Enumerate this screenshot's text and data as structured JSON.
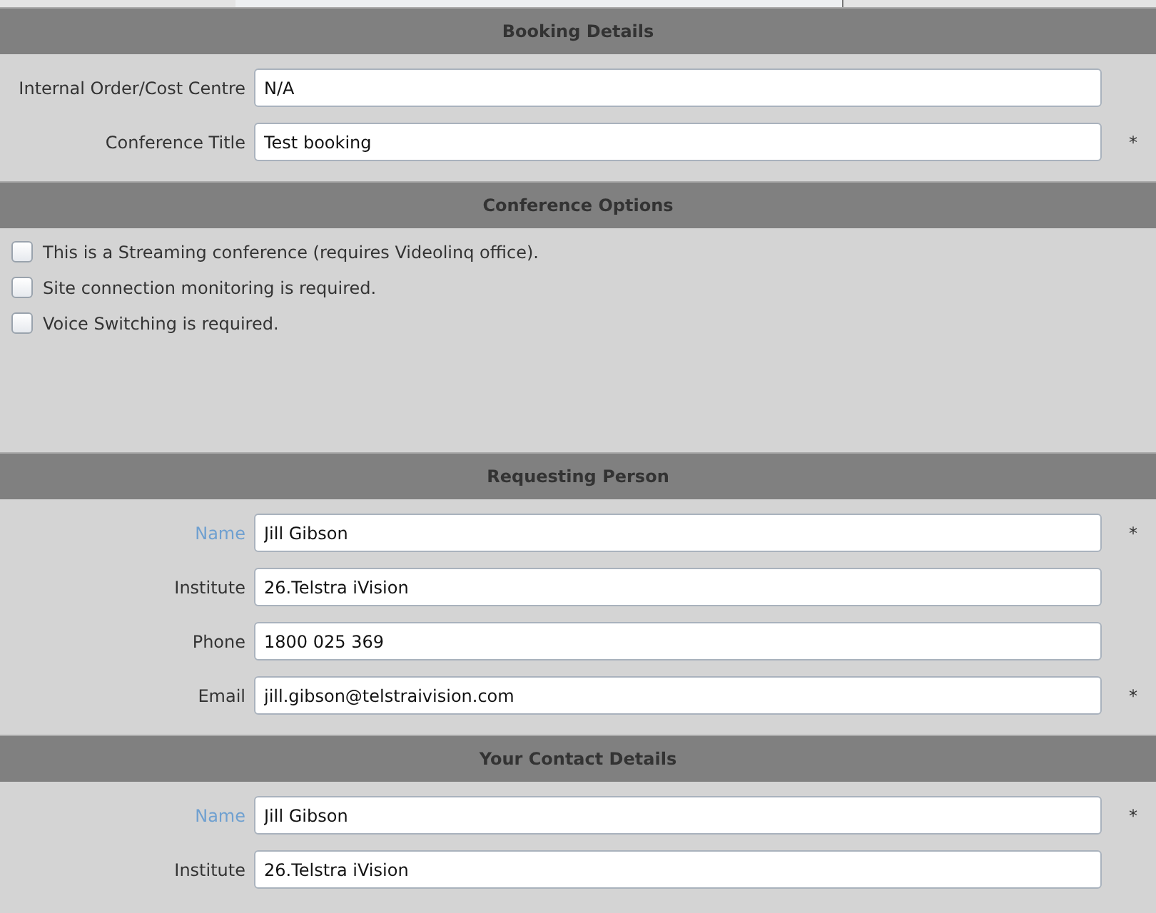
{
  "sections": [
    {
      "title": "Booking Details",
      "kind": "fields",
      "fields": [
        {
          "label": "Internal Order/Cost Centre",
          "value": "N/A",
          "link": false
        },
        {
          "label": "Conference Title",
          "value": "Test booking",
          "link": false,
          "marker": "*"
        }
      ]
    },
    {
      "title": "Conference Options",
      "kind": "checkboxes",
      "options": [
        {
          "label": "This is a Streaming conference (requires Videolinq office).",
          "checked": false
        },
        {
          "label": "Site connection monitoring is required.",
          "checked": false
        },
        {
          "label": "Voice Switching is required.",
          "checked": false
        }
      ]
    },
    {
      "title": "Requesting Person",
      "kind": "fields",
      "fields": [
        {
          "label": "Name",
          "value": "Jill Gibson",
          "link": true,
          "marker": "*"
        },
        {
          "label": "Institute",
          "value": "26.Telstra iVision",
          "link": false
        },
        {
          "label": "Phone",
          "value": "1800 025 369",
          "link": false
        },
        {
          "label": "Email",
          "value": "jill.gibson@telstraivision.com",
          "link": false,
          "marker": "*"
        }
      ]
    },
    {
      "title": "Your Contact Details",
      "kind": "fields",
      "fields": [
        {
          "label": "Name",
          "value": "Jill Gibson",
          "link": true,
          "marker": "*"
        },
        {
          "label": "Institute",
          "value": "26.Telstra iVision",
          "link": false
        }
      ]
    }
  ]
}
